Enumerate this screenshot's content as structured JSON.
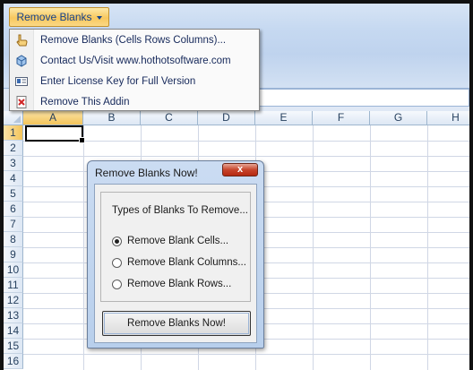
{
  "ribbon": {
    "addin_button_label": "Remove Blanks"
  },
  "menu": {
    "items": [
      {
        "label": "Remove Blanks (Cells Rows Columns)...",
        "icon": "pointing-hand-icon"
      },
      {
        "label": "Contact Us/Visit www.hothotsoftware.com",
        "icon": "cube-icon"
      },
      {
        "label": "Enter License Key for Full Version",
        "icon": "license-card-icon"
      },
      {
        "label": "Remove This Addin",
        "icon": "remove-document-icon"
      }
    ]
  },
  "sheet": {
    "columns": [
      "A",
      "B",
      "C",
      "D",
      "E",
      "F",
      "G",
      "H"
    ],
    "rows": [
      "1",
      "2",
      "3",
      "4",
      "5",
      "6",
      "7",
      "8",
      "9",
      "10",
      "11",
      "12",
      "13",
      "14",
      "15",
      "16"
    ],
    "selected_cell": "A1"
  },
  "dialog": {
    "title": "Remove Blanks Now!",
    "close_label": "x",
    "group_title": "Types of Blanks To Remove...",
    "options": [
      {
        "label": "Remove Blank Cells...",
        "selected": true
      },
      {
        "label": "Remove Blank Columns...",
        "selected": false
      },
      {
        "label": "Remove Blank Rows...",
        "selected": false
      }
    ],
    "action_label": "Remove Blanks Now!"
  },
  "colors": {
    "ribbon_bg": "#c6d9f1",
    "highlight": "#f7c75e",
    "menu_text": "#15285a",
    "close_red": "#c7452c"
  }
}
